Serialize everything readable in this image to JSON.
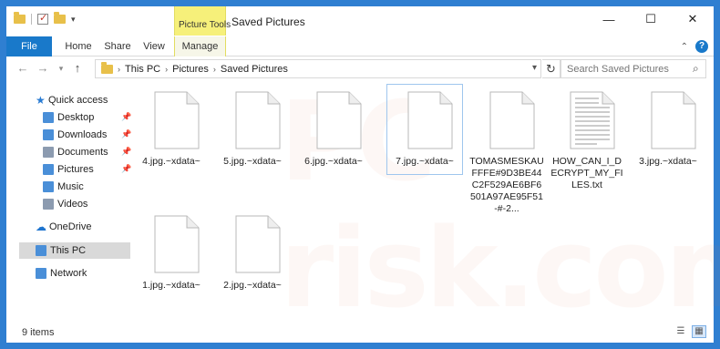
{
  "window": {
    "title": "Saved Pictures",
    "context_tab": "Picture Tools",
    "controls": {
      "minimize": "—",
      "maximize": "☐",
      "close": "✕"
    }
  },
  "ribbon": {
    "tabs": [
      "File",
      "Home",
      "Share",
      "View",
      "Manage"
    ],
    "collapse": "⌃",
    "help": "?"
  },
  "address": {
    "crumbs": [
      "This PC",
      "Pictures",
      "Saved Pictures"
    ],
    "search_placeholder": "Search Saved Pictures"
  },
  "sidebar": {
    "items": [
      {
        "label": "Quick access",
        "icon": "star-icon"
      },
      {
        "label": "Desktop",
        "icon": "desktop-folder-icon",
        "pinned": true
      },
      {
        "label": "Downloads",
        "icon": "downloads-folder-icon",
        "pinned": true
      },
      {
        "label": "Documents",
        "icon": "documents-folder-icon",
        "pinned": true
      },
      {
        "label": "Pictures",
        "icon": "pictures-folder-icon",
        "pinned": true
      },
      {
        "label": "Music",
        "icon": "music-folder-icon"
      },
      {
        "label": "Videos",
        "icon": "videos-folder-icon"
      },
      {
        "label": "OneDrive",
        "icon": "cloud-icon"
      },
      {
        "label": "This PC",
        "icon": "computer-icon",
        "selected": true
      },
      {
        "label": "Network",
        "icon": "network-icon"
      }
    ]
  },
  "files": [
    {
      "name": "4.jpg.~xdata~",
      "type": "blank"
    },
    {
      "name": "5.jpg.~xdata~",
      "type": "blank"
    },
    {
      "name": "6.jpg.~xdata~",
      "type": "blank"
    },
    {
      "name": "7.jpg.~xdata~",
      "type": "blank",
      "focused": true
    },
    {
      "name": "TOMASMESKAUFFFE#9D3BE44C2F529AE6BF6501A97AE95F51-#-2...",
      "type": "blank"
    },
    {
      "name": "HOW_CAN_I_DECRYPT_MY_FILES.txt",
      "type": "text"
    },
    {
      "name": "3.jpg.~xdata~",
      "type": "blank"
    },
    {
      "name": "1.jpg.~xdata~",
      "type": "blank"
    },
    {
      "name": "2.jpg.~xdata~",
      "type": "blank"
    }
  ],
  "status": {
    "count": "9 items"
  },
  "watermark": "PC risk.com"
}
